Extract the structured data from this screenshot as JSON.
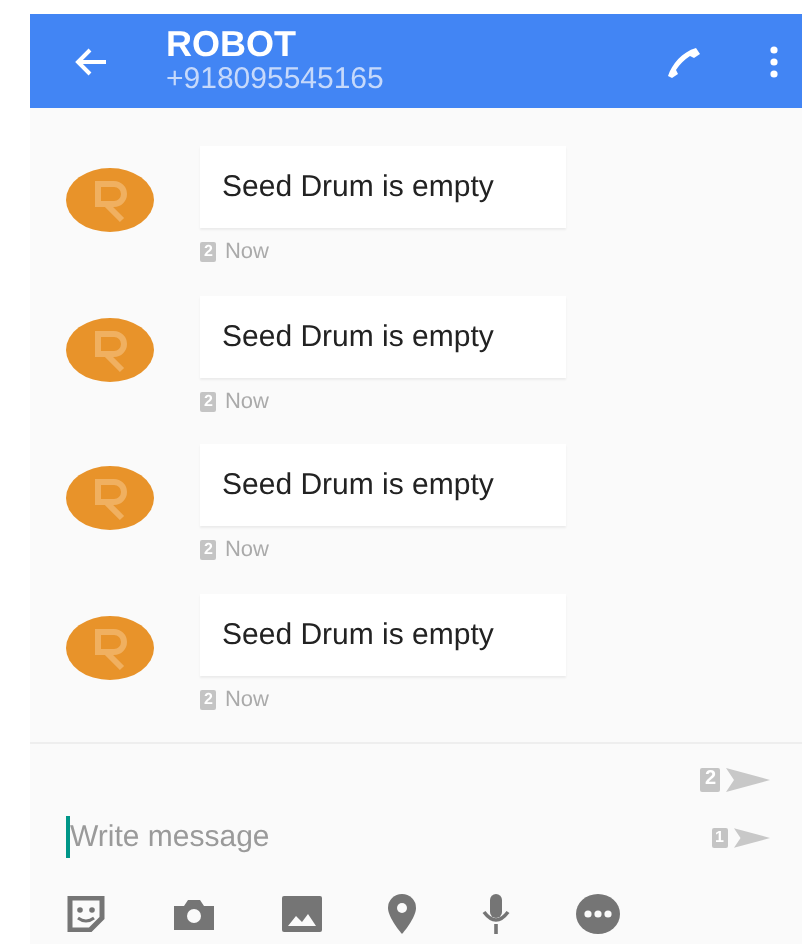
{
  "header": {
    "title": "ROBOT",
    "subtitle": "+918095545165"
  },
  "messages": [
    {
      "text": "Seed Drum is empty",
      "sim": "2",
      "time": "Now"
    },
    {
      "text": "Seed Drum is empty",
      "sim": "2",
      "time": "Now"
    },
    {
      "text": "Seed Drum is empty",
      "sim": "2",
      "time": "Now"
    },
    {
      "text": "Seed Drum is empty",
      "sim": "2",
      "time": "Now"
    }
  ],
  "compose": {
    "placeholder": "Write message",
    "send_buttons": [
      {
        "sim": "2"
      },
      {
        "sim": "1"
      }
    ]
  },
  "toolbar": [
    {
      "kind": "sticker"
    },
    {
      "kind": "camera"
    },
    {
      "kind": "image"
    },
    {
      "kind": "location"
    },
    {
      "kind": "mic"
    },
    {
      "kind": "more"
    }
  ]
}
